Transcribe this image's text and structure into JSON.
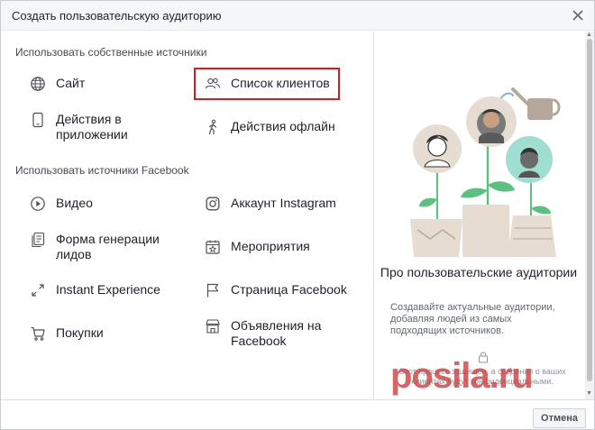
{
  "dialog": {
    "title": "Создать пользовательскую аудиторию"
  },
  "sections": {
    "own": "Использовать собственные источники",
    "facebook": "Использовать источники Facebook"
  },
  "options": {
    "site": "Сайт",
    "customer_list": "Список клиентов",
    "app_activity": "Действия в приложении",
    "offline_activity": "Действия офлайн",
    "video": "Видео",
    "instagram": "Аккаунт Instagram",
    "lead_form": "Форма генерации лидов",
    "events": "Мероприятия",
    "instant_experience": "Instant Experience",
    "facebook_page": "Страница Facebook",
    "shopping": "Покупки",
    "marketplace": "Объявления на Facebook"
  },
  "info": {
    "title": "Про пользовательские аудитории",
    "description": "Создавайте актуальные аудитории, добавляя людей из самых подходящих источников.",
    "privacy_note": "Этот процесс защищен, а сведения о ваших клиентах будут конфиденциальными."
  },
  "footer": {
    "cancel": "Отмена"
  },
  "watermark": "posila.ru",
  "colors": {
    "highlight": "#e0161c",
    "teal": "#9fded0",
    "leaf": "#5fbf80",
    "pot": "#e6dcd2",
    "watering_can": "#b5a89b"
  },
  "icons": {
    "site": "globe-icon",
    "customer_list": "people-icon",
    "app_activity": "phone-icon",
    "offline_activity": "walking-person-icon",
    "video": "play-circle-icon",
    "instagram": "instagram-icon",
    "lead_form": "form-icon",
    "events": "calendar-star-icon",
    "instant_experience": "expand-arrows-icon",
    "facebook_page": "flag-icon",
    "shopping": "cart-icon",
    "marketplace": "storefront-icon"
  }
}
